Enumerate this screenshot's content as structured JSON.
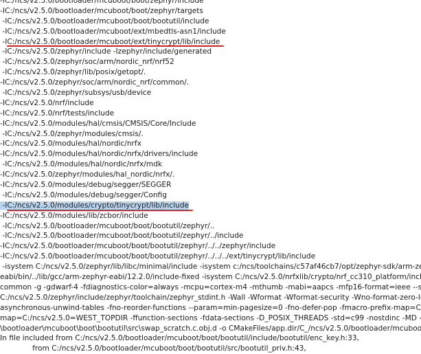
{
  "log_lines": [
    {
      "text": "-IC:/ncs/v2.5.0/bootloader/mcuboot/boot/zephyr/include"
    },
    {
      "text": "-IC:/ncs/v2.5.0/bootloader/mcuboot/boot/zephyr/targets"
    },
    {
      "text": " -IC:/ncs/v2.5.0/bootloader/mcuboot/boot/bootutil/include"
    },
    {
      "text": " -IC:/ncs/v2.5.0/bootloader/mcuboot/ext/mbedtls-asn1/include"
    },
    {
      "text": " -IC:/ncs/v2.5.0/bootloader/mcuboot/ext/tinycrypt/lib/include",
      "marked": true
    },
    {
      "text": " -IC:/ncs/v2.5.0/zephyr/include -Izephyr/include/generated"
    },
    {
      "text": " -IC:/ncs/v2.5.0/zephyr/soc/arm/nordic_nrf/nrf52"
    },
    {
      "text": " -IC:/ncs/v2.5.0/zephyr/lib/posix/getopt/."
    },
    {
      "text": "-IC:/ncs/v2.5.0/zephyr/soc/arm/nordic_nrf/common/."
    },
    {
      "text": " -IC:/ncs/v2.5.0/zephyr/subsys/usb/device"
    },
    {
      "text": "-IC:/ncs/v2.5.0/nrf/include"
    },
    {
      "text": "-IC:/ncs/v2.5.0/nrf/tests/include"
    },
    {
      "text": "-IC:/ncs/v2.5.0/modules/hal/cmsis/CMSIS/Core/Include"
    },
    {
      "text": " -IC:/ncs/v2.5.0/zephyr/modules/cmsis/."
    },
    {
      "text": "-IC:/ncs/v2.5.0/modules/hal/nordic/nrfx"
    },
    {
      "text": "-IC:/ncs/v2.5.0/modules/hal/nordic/nrfx/drivers/include"
    },
    {
      "text": " -IC:/ncs/v2.5.0/modules/hal/nordic/nrfx/mdk"
    },
    {
      "text": "-IC:/ncs/v2.5.0/zephyr/modules/hal_nordic/nrfx/."
    },
    {
      "text": "-IC:/ncs/v2.5.0/modules/debug/segger/SEGGER"
    },
    {
      "text": " -IC:/ncs/v2.5.0/modules/debug/segger/Config"
    },
    {
      "text": " -IC:/ncs/v2.5.0/modules/crypto/tinycrypt/lib/include",
      "highlighted": true,
      "marked": true
    },
    {
      "text": "-IC:/ncs/v2.5.0/modules/lib/zcbor/include"
    },
    {
      "text": " -IC:/ncs/v2.5.0/bootloader/mcuboot/boot/bootutil/zephyr/.."
    },
    {
      "text": " -IC:/ncs/v2.5.0/bootloader/mcuboot/boot/bootutil/zephyr/../include"
    },
    {
      "text": "-IC:/ncs/v2.5.0/bootloader/mcuboot/boot/bootutil/zephyr/../../zephyr/include"
    },
    {
      "text": "-IC:/ncs/v2.5.0/bootloader/mcuboot/boot/bootutil/zephyr/../../../ext/tinycrypt/lib/include"
    },
    {
      "text": " -isystem C:/ncs/v2.5.0/zephyr/lib/libc/minimal/include -isystem c:/ncs/toolchains/c57af46cb7/opt/zephyr-sdk/arm-zephyr-"
    },
    {
      "text": "eabi/bin/../lib/gcc/arm-zephyr-eabi/12.2.0/include-fixed -isystem C:/ncs/v2.5.0/nrfxlib/crypto/nrf_cc310_platform/include"
    },
    {
      "text": "common -g -gdwarf-4 -fdiagnostics-color=always -mcpu=cortex-m4 -mthumb -mabi=aapcs -mfp16-format=ieee --sysroot="
    },
    {
      "text": "C:/ncs/v2.5.0/zephyr/include/zephyr/toolchain/zephyr_stdint.h -Wall -Wformat -Wformat-security -Wno-format-zero-length"
    },
    {
      "text": "asynchronous-unwind-tables -fno-reorder-functions --param=min-pagesize=0 -fno-defer-pop -fmacro-prefix-map=C:/ncs/"
    },
    {
      "text": "map=C:/ncs/v2.5.0=WEST_TOPDIR -ffunction-sections -fdata-sections -D_POSIX_THREADS -std=c99 -nostdinc -MD -MT"
    },
    {
      "text": "\\bootloader\\mcuboot\\boot\\bootutil\\src\\swap_scratch.c.obj.d -o CMakeFiles/app.dir/C_/ncs/v2.5.0/bootloader/mcuboot/"
    },
    {
      "text": "In file included from C:/ncs/v2.5.0/bootloader/mcuboot/boot/bootutil/include/bootutil/enc_key.h:33,"
    },
    {
      "text": "              from C:/ncs/v2.5.0/bootloader/mcuboot/boot/bootutil/src/bootutil_priv.h:43,"
    }
  ],
  "colors": {
    "text": "#1a1a1a",
    "highlight": "#b9d4ef",
    "underline": "#e0201a"
  }
}
